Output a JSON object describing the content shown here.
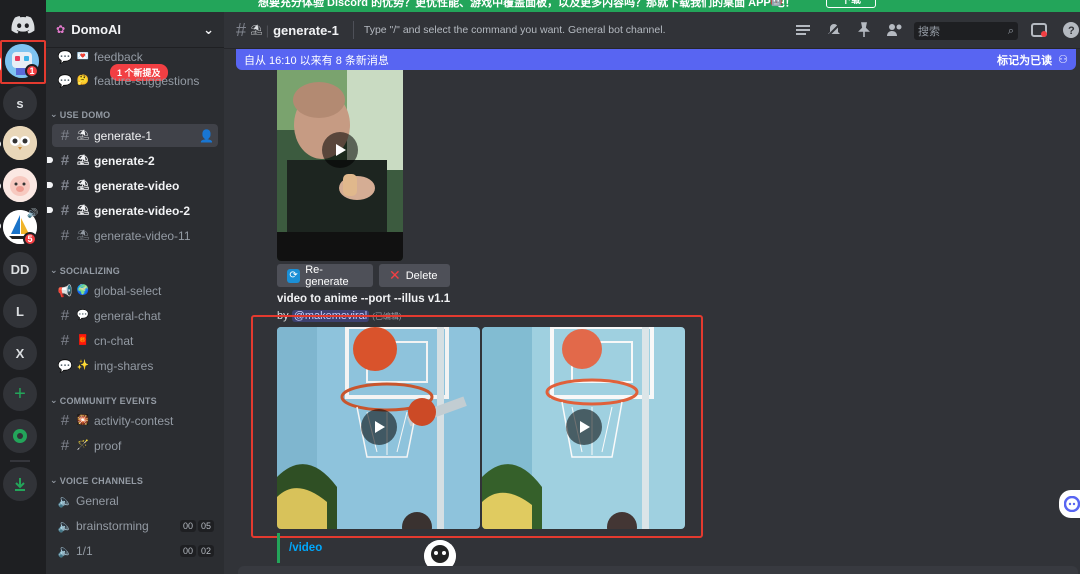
{
  "banner": {
    "text": "想要充分体验 Discord 的优势？更优性能、游戏中覆盖面板，以及更多内容吗？那就下载我们的桌面 APP 吧！",
    "download_label": "下载"
  },
  "servers": {
    "items": [
      {
        "name": "discord-home",
        "type": "logo"
      },
      {
        "name": "domoai",
        "type": "avatar",
        "badge": "1"
      },
      {
        "name": "s",
        "label": "s"
      },
      {
        "name": "server-owl",
        "type": "avatar"
      },
      {
        "name": "server-pig",
        "type": "avatar"
      },
      {
        "name": "server-sailboat",
        "type": "avatar",
        "badge": "5"
      },
      {
        "name": "dd",
        "label": "DD"
      },
      {
        "name": "l",
        "label": "L"
      },
      {
        "name": "x",
        "label": "X"
      },
      {
        "name": "add-server",
        "icon": "plus-icon"
      },
      {
        "name": "explore",
        "icon": "compass-icon"
      },
      {
        "name": "download-apps",
        "icon": "download-icon"
      }
    ]
  },
  "sidebar": {
    "server_name": "DomoAI",
    "new_mentions_pill": "1 个新提及",
    "top_channels": [
      {
        "label": "feedback",
        "emoji": "💌"
      },
      {
        "label": "feature-suggestions",
        "emoji": "🤔"
      }
    ],
    "categories": {
      "use_domo": "USE DOMO",
      "socializing": "SOCIALIZING",
      "community_events": "COMMUNITY EVENTS",
      "voice_channels": "VOICE CHANNELS"
    },
    "use_domo_channels": [
      {
        "label": "generate-1",
        "emoji": "⛱",
        "state": "active"
      },
      {
        "label": "generate-2",
        "emoji": "⛱",
        "state": "unread"
      },
      {
        "label": "generate-video",
        "emoji": "⛱",
        "state": "unread"
      },
      {
        "label": "generate-video-2",
        "emoji": "⛱",
        "state": "unread"
      },
      {
        "label": "generate-video-11",
        "emoji": "⛱",
        "state": "normal"
      }
    ],
    "socializing_channels": [
      {
        "label": "global-select",
        "emoji": "🌍",
        "kind": "announcement"
      },
      {
        "label": "general-chat",
        "emoji": "💬",
        "kind": "text"
      },
      {
        "label": "cn-chat",
        "emoji": "🧧",
        "kind": "text"
      },
      {
        "label": "img-shares",
        "emoji": "✨",
        "kind": "forum"
      }
    ],
    "event_channels": [
      {
        "label": "activity-contest",
        "emoji": "🎇"
      },
      {
        "label": "proof",
        "emoji": "🪄"
      }
    ],
    "voice_channels": [
      {
        "label": "General"
      },
      {
        "label": "brainstorming",
        "count_left": "00",
        "count_right": "05"
      },
      {
        "label": "1/1",
        "count_left": "00",
        "count_right": "02"
      }
    ]
  },
  "header": {
    "channel": "generate-1",
    "topic": "Type \"/\" and select the command you want. General bot channel.",
    "search_placeholder": "搜索"
  },
  "new_messages_bar": {
    "text": "自从 16:10 以来有 8 条新消息",
    "mark_read": "标记为已读"
  },
  "messages": {
    "regenerate_label": "Re-generate",
    "delete_label": "Delete",
    "video_title": "video to anime --port --illus v1.1",
    "by_prefix": "by",
    "mention": "@makemeviral",
    "edited": "(已编辑)",
    "slash_command": "/video"
  },
  "colors": {
    "accent": "#5865f2",
    "green": "#23a55a",
    "red": "#f23f43",
    "highlight_box": "#e33a2f"
  }
}
